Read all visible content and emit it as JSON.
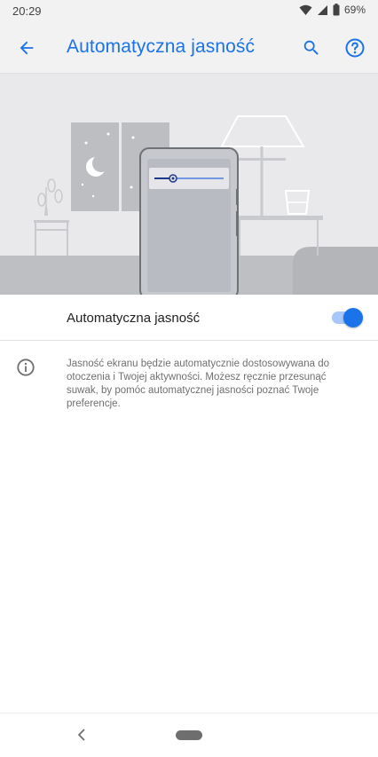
{
  "status_bar": {
    "time": "20:29",
    "battery": "69%",
    "icons": [
      "wifi-icon",
      "signal-icon",
      "battery-icon"
    ]
  },
  "app_bar": {
    "title": "Automatyczna jasność",
    "icons": [
      "back-arrow-icon",
      "search-icon",
      "help-icon"
    ]
  },
  "setting": {
    "label": "Automatyczna jasność",
    "enabled": true
  },
  "info": {
    "text": "Jasność ekranu będzie automatycznie dostosowywana do otoczenia i Twojej aktywności. Możesz ręcznie przesunąć suwak, by pomóc automatycznej jasności poznać Twoje preferencje."
  },
  "colors": {
    "accent": "#1a73e8",
    "illustration_bg": "#e9e9ec",
    "track": "#a8c7fa"
  },
  "nav": {
    "icons": [
      "nav-back-icon",
      "nav-home-pill"
    ]
  }
}
